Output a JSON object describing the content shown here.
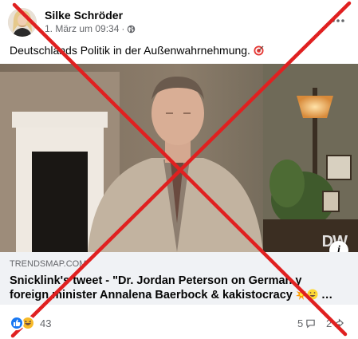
{
  "post": {
    "author": "Silke Schröder",
    "date": "1. März um 09:34",
    "date_separator": "·",
    "audience_icon": "globe-icon",
    "text": "Deutschlands Politik in der Außenwahrnehmung.",
    "text_emoji": "target-emoji"
  },
  "media": {
    "watermark": "DW"
  },
  "link_preview": {
    "domain": "TRENDSMAP.COM",
    "title_line1": "Snicklink's tweet - \"Dr. Jordan Peterson on German y",
    "title_line2": "foreign minister Annalena Baerbock & kakistocracy",
    "title_ellipsis": " …"
  },
  "footer": {
    "reaction_count": "43",
    "comment_count": "5",
    "share_count": "2"
  },
  "colors": {
    "cross": "#e02020",
    "like": "#1877f2",
    "haha": "#f7b928",
    "preview_bg": "#f0f2f5",
    "muted": "#65676b"
  }
}
